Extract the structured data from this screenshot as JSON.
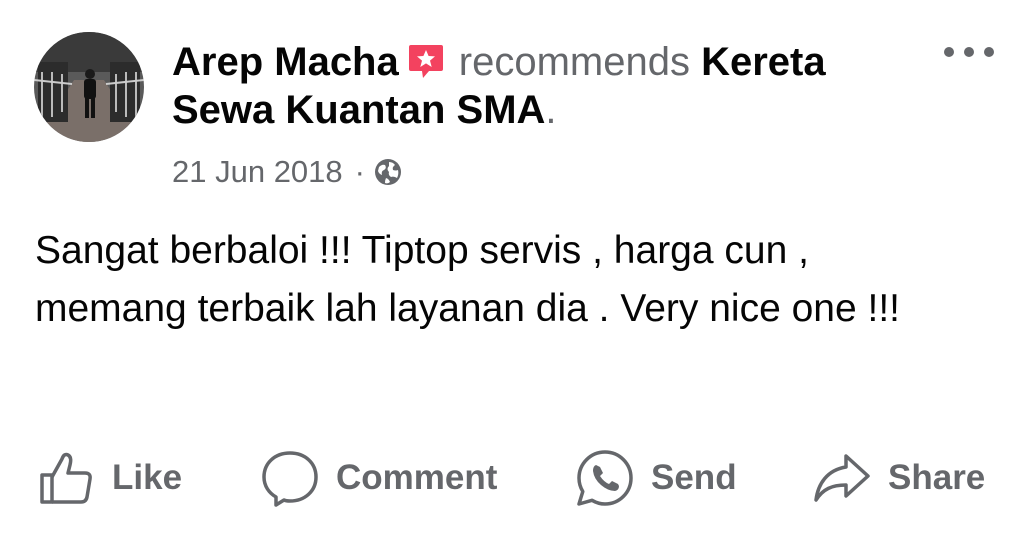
{
  "post": {
    "author": "Arep Macha",
    "verb": "recommends",
    "page_name": "Kereta Sewa Kuantan SMA",
    "end_punct": ".",
    "date": "21 Jun 2018",
    "meta_sep": "·",
    "privacy_icon": "globe-icon",
    "text": "Sangat berbaloi !!! Tiptop servis , harga cun , memang terbaik lah layanan dia . Very nice one !!!"
  },
  "actions": {
    "like": "Like",
    "comment": "Comment",
    "send": "Send",
    "share": "Share"
  },
  "colors": {
    "secondary_text": "#65676b",
    "badge_red": "#f3425f"
  }
}
